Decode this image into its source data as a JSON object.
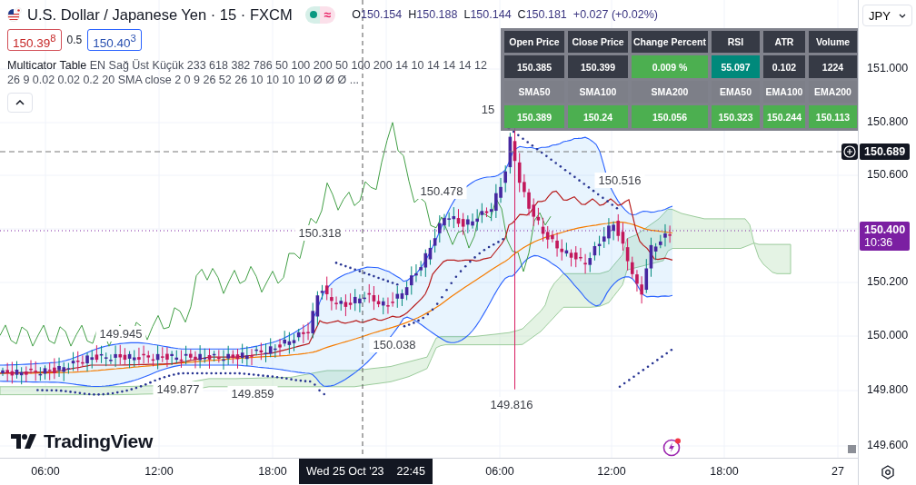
{
  "header": {
    "title": "U.S. Dollar / Japanese Yen · 15 · FXCM",
    "status_symbol": "≈",
    "ohlc": [
      {
        "label": "O",
        "value": "150.154"
      },
      {
        "label": "H",
        "value": "150.188"
      },
      {
        "label": "L",
        "value": "150.144"
      },
      {
        "label": "C",
        "value": "150.181"
      }
    ],
    "change": "+0.027 (+0.02%)"
  },
  "quote": {
    "sell": "150.39$^{8}$",
    "spread": "0.5",
    "buy": "150.40$^{3}$"
  },
  "indicator": {
    "name": "Multicator Table",
    "args": "EN Sağ Üst Küçük 233 618 382 786 50 100 200 50 100 200 14 10 14 14 14 12 26 9 0.02 0.02 0.2 20 SMA close 2 0 9 26 52 26 10 10 10 10 Ø Ø Ø ..."
  },
  "table": {
    "rows": [
      {
        "kind": "label",
        "cells": [
          {
            "text": "Open Price",
            "color": "#363a45"
          },
          {
            "text": "Close Price",
            "color": "#363a45"
          },
          {
            "text": "Change Percent",
            "color": "#363a45"
          },
          {
            "text": "RSI",
            "color": "#363a45"
          },
          {
            "text": "ATR",
            "color": "#363a45"
          },
          {
            "text": "Volume",
            "color": "#363a45"
          }
        ]
      },
      {
        "kind": "value",
        "cells": [
          {
            "text": "150.385",
            "color": "#363a45"
          },
          {
            "text": "150.399",
            "color": "#363a45"
          },
          {
            "text": "0.009 %",
            "color": "#4caf50"
          },
          {
            "text": "55.097",
            "color": "#00897b"
          },
          {
            "text": "0.102",
            "color": "#363a45"
          },
          {
            "text": "1224",
            "color": "#363a45"
          }
        ]
      },
      {
        "kind": "label",
        "cells": [
          {
            "text": "SMA50",
            "color": "#7d7f88"
          },
          {
            "text": "SMA100",
            "color": "#7d7f88"
          },
          {
            "text": "SMA200",
            "color": "#7d7f88"
          },
          {
            "text": "EMA50",
            "color": "#7d7f88"
          },
          {
            "text": "EMA100",
            "color": "#7d7f88"
          },
          {
            "text": "EMA200",
            "color": "#7d7f88"
          }
        ]
      },
      {
        "kind": "value",
        "cells": [
          {
            "text": "150.389",
            "color": "#4caf50"
          },
          {
            "text": "150.24",
            "color": "#4caf50"
          },
          {
            "text": "150.056",
            "color": "#4caf50"
          },
          {
            "text": "150.323",
            "color": "#4caf50"
          },
          {
            "text": "150.244",
            "color": "#4caf50"
          },
          {
            "text": "150.113",
            "color": "#4caf50"
          }
        ]
      }
    ]
  },
  "annotations": [
    "15",
    "150.478",
    "150.516",
    "150.318",
    "149.945",
    "150.038",
    "149.877",
    "149.859",
    "149.816"
  ],
  "currency": "JPY",
  "price_axis": {
    "labels": [
      "151.000",
      "150.800",
      "150.600",
      "150.200",
      "150.000",
      "149.800",
      "149.600"
    ],
    "crosshair_price": "150.689",
    "last_price": "150.400",
    "countdown": "10:36"
  },
  "brand": "TradingView",
  "time_axis": {
    "labels": [
      "06:00",
      "12:00",
      "18:00",
      "06:00",
      "12:00",
      "18:00",
      "27"
    ],
    "crosshair_date": "Wed 25 Oct '23",
    "crosshair_time": "22:45"
  }
}
